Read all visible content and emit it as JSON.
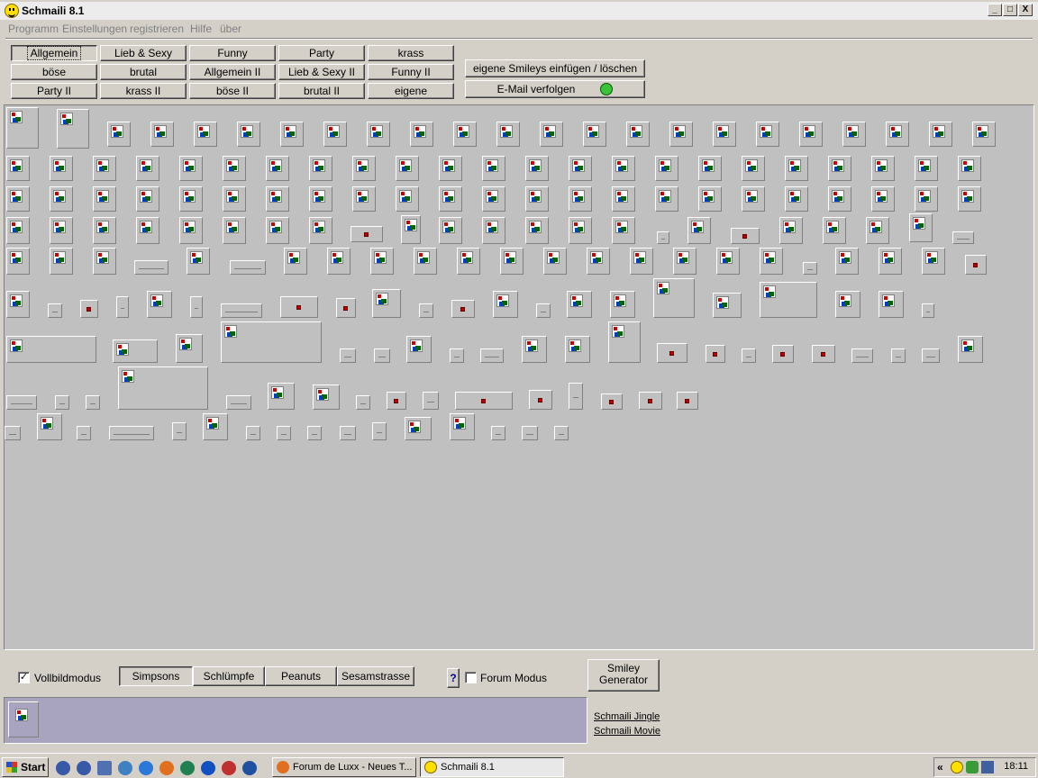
{
  "window": {
    "title": "Schmaili 8.1",
    "controls": [
      "_",
      "□",
      "X"
    ]
  },
  "menu": [
    "Programm",
    "Einstellungen",
    "registrieren",
    "Hilfe",
    "über"
  ],
  "categories": [
    [
      "Allgemein",
      "Lieb & Sexy",
      "Funny",
      "Party",
      "krass"
    ],
    [
      "böse",
      "brutal",
      "Allgemein II",
      "Lieb & Sexy II",
      "Funny II"
    ],
    [
      "Party II",
      "krass II",
      "böse II",
      "brutal II",
      "eigene"
    ]
  ],
  "active_category": "Allgemein",
  "actions": {
    "own_smileys": "eigene Smileys einfügen / löschen",
    "email": "E-Mail verfolgen"
  },
  "bottom": {
    "fullscreen_label": "Vollbildmodus",
    "fullscreen_checked": true,
    "tabs": [
      "Simpsons",
      "Schlümpfe",
      "Peanuts",
      "Sesamstrasse"
    ],
    "active_tab": "Simpsons",
    "help_label": "?",
    "forum_label": "Forum Modus",
    "forum_checked": false,
    "generator_label_1": "Smiley",
    "generator_label_2": "Generator",
    "link_jingle": "Schmaili Jingle",
    "link_movie": "Schmaili Movie"
  },
  "taskbar": {
    "start": "Start",
    "tasks": [
      "Forum de Luxx - Neues T...",
      "Schmaili 8.1"
    ],
    "active_task": "Schmaili 8.1",
    "tray_chevron": "«",
    "clock": "18:11"
  },
  "colors": {
    "face": "#d4d0c8",
    "canvas": "#c0c0c0",
    "preview": "#a8a4c0",
    "title_bar": "#ececec"
  }
}
